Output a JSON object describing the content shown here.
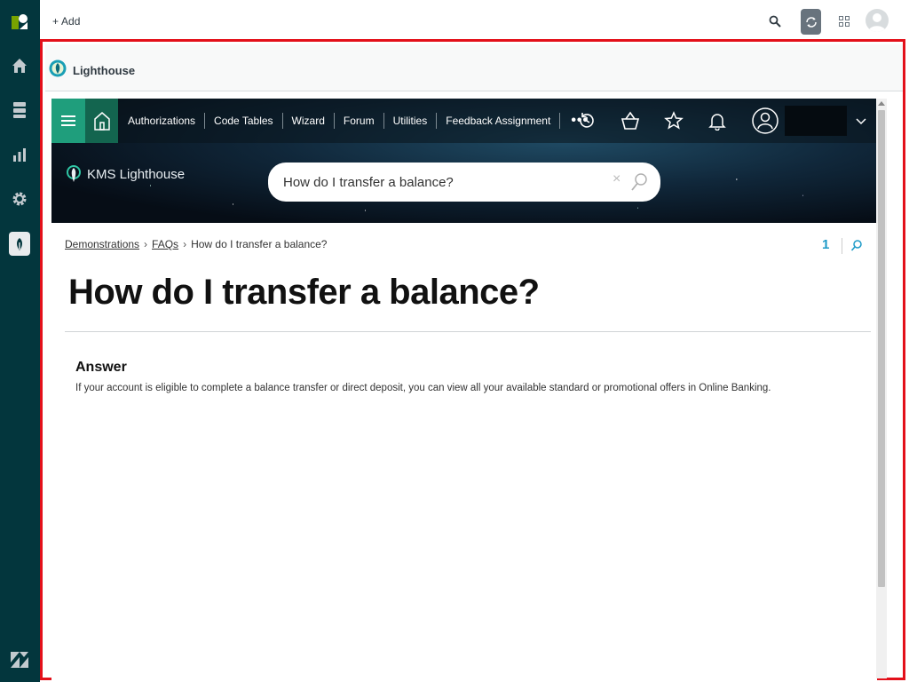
{
  "topbar": {
    "add_label": "Add"
  },
  "sidebar": {
    "items": [
      {
        "name": "home",
        "icon": "home-icon"
      },
      {
        "name": "views",
        "icon": "stack-icon"
      },
      {
        "name": "reporting",
        "icon": "bar-chart-icon"
      },
      {
        "name": "admin",
        "icon": "gear-icon"
      },
      {
        "name": "lighthouse-app",
        "icon": "lighthouse-app-icon"
      }
    ]
  },
  "app": {
    "title": "Lighthouse"
  },
  "kms": {
    "nav": {
      "links": [
        "Authorizations",
        "Code Tables",
        "Wizard",
        "Forum",
        "Utilities",
        "Feedback Assignment"
      ],
      "more": "•••"
    },
    "brand": "KMS Lighthouse",
    "search": {
      "value": "How do I transfer a balance?",
      "clear": "×"
    },
    "breadcrumb": {
      "items": [
        "Demonstrations",
        "FAQs"
      ],
      "current": "How do I transfer a balance?",
      "separator": "›"
    },
    "result_count": "1",
    "article": {
      "title": "How do I transfer a balance?",
      "answer_heading": "Answer",
      "answer_text": "If your account is eligible to complete a balance transfer or direct deposit, you can view all your available standard or promotional offers in Online Banking."
    }
  },
  "colors": {
    "sidebar_bg": "#03363d",
    "frame_border": "#e3101a",
    "nav_accent": "#1f9e7c",
    "nav_home": "#13654f",
    "count_blue": "#1e9ac7"
  }
}
